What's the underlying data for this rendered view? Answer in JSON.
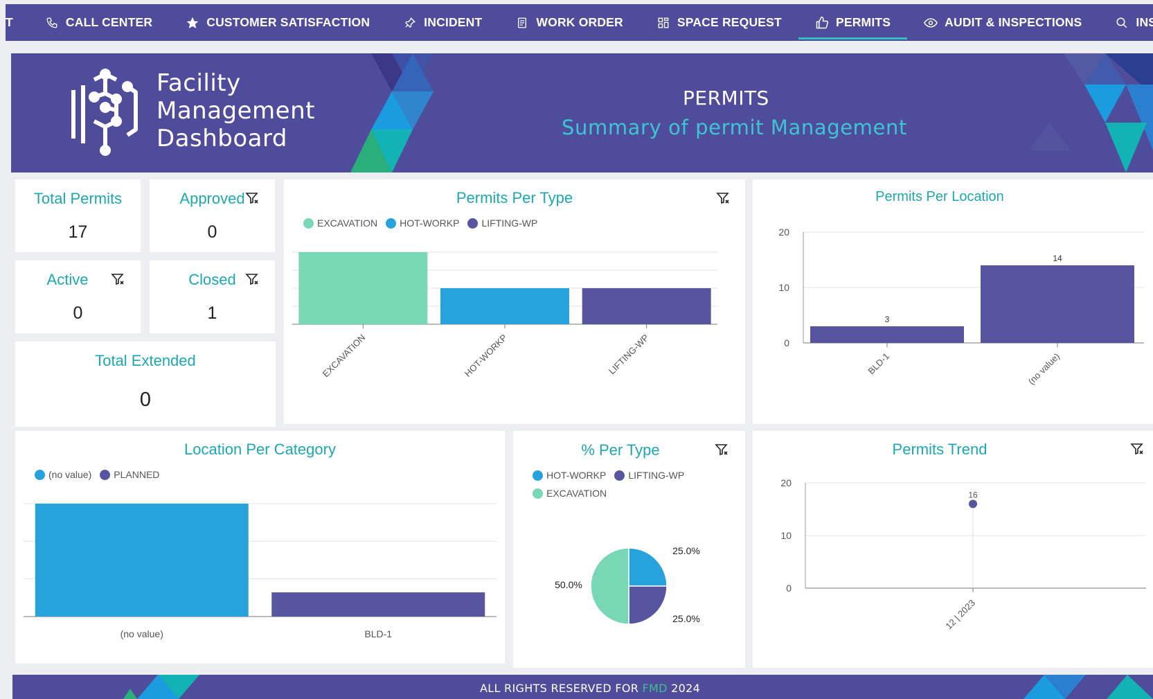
{
  "nav": {
    "items": [
      {
        "label": "T",
        "icon": "cut-off-icon"
      },
      {
        "label": "CALL CENTER",
        "icon": "phone-icon"
      },
      {
        "label": "CUSTOMER SATISFACTION",
        "icon": "star-icon"
      },
      {
        "label": "INCIDENT",
        "icon": "pin-icon"
      },
      {
        "label": "WORK ORDER",
        "icon": "clipboard-icon"
      },
      {
        "label": "SPACE REQUEST",
        "icon": "grid-icon"
      },
      {
        "label": "PERMITS",
        "icon": "thumbs-up-icon",
        "active": true
      },
      {
        "label": "AUDIT & INSPECTIONS",
        "icon": "eye-icon"
      },
      {
        "label": "INSPEC",
        "icon": "search-icon"
      }
    ],
    "accent_color": "#2ec0c4"
  },
  "header": {
    "brand_line1": "Facility",
    "brand_line2": "Management",
    "brand_line3": "Dashboard",
    "title": "PERMITS",
    "subtitle": "Summary of permit Management",
    "background_color": "#4f4c9b"
  },
  "kpis": {
    "total_permits": {
      "label": "Total Permits",
      "value": "17"
    },
    "approved": {
      "label": "Approved",
      "value": "0"
    },
    "active": {
      "label": "Active",
      "value": "0"
    },
    "closed": {
      "label": "Closed",
      "value": "1"
    },
    "total_extended": {
      "label": "Total Extended",
      "value": "0"
    }
  },
  "panels": {
    "permits_per_type": "Permits Per Type",
    "permits_per_location": "Permits Per Location",
    "location_per_category": "Location Per Category",
    "percent_per_type": "% Per Type",
    "permits_trend": "Permits Trend"
  },
  "colors": {
    "excavation": "#78d8b6",
    "hot_workp": "#27a2dc",
    "lifting_wp": "#57559f",
    "title_teal": "#1ea7b3"
  },
  "chart_data": [
    {
      "id": "permits_per_type",
      "type": "bar",
      "title": "Permits Per Type",
      "categories": [
        "EXCAVATION",
        "HOT-WORKP",
        "LIFTING-WP"
      ],
      "values": [
        2,
        1,
        1
      ],
      "colors": [
        "#78d8b6",
        "#27a2dc",
        "#57559f"
      ],
      "legend": [
        "EXCAVATION",
        "HOT-WORKP",
        "LIFTING-WP"
      ],
      "ylim": [
        0,
        2
      ],
      "grid": true,
      "legend_position": "top-left"
    },
    {
      "id": "permits_per_location",
      "type": "bar",
      "title": "Permits Per Location",
      "categories": [
        "BLD-1",
        "(no value)"
      ],
      "values": [
        3,
        14
      ],
      "data_labels": [
        "3",
        "14"
      ],
      "y_ticks": [
        "0",
        "10",
        "20"
      ],
      "ylim": [
        0,
        20
      ],
      "color": "#57559f",
      "grid": true
    },
    {
      "id": "location_per_category",
      "type": "bar",
      "title": "Location Per Category",
      "categories": [
        "(no value)",
        "BLD-1"
      ],
      "series": [
        {
          "name": "(no value)",
          "values": [
            14,
            null
          ]
        },
        {
          "name": "PLANNED",
          "values": [
            null,
            3
          ]
        }
      ],
      "colors": [
        "#27a2dc",
        "#57559f"
      ],
      "legend": [
        "(no value)",
        "PLANNED"
      ],
      "ylim": [
        0,
        14
      ],
      "grid": true,
      "legend_position": "top-left"
    },
    {
      "id": "percent_per_type",
      "type": "pie",
      "title": "% Per Type",
      "labels": [
        "HOT-WORKP",
        "LIFTING-WP",
        "EXCAVATION"
      ],
      "values": [
        25.0,
        25.0,
        50.0
      ],
      "data_labels": [
        "25.0%",
        "25.0%",
        "50.0%"
      ],
      "colors": [
        "#27a2dc",
        "#57559f",
        "#78d8b6"
      ],
      "legend": [
        "HOT-WORKP",
        "LIFTING-WP",
        "EXCAVATION"
      ],
      "legend_position": "top-left"
    },
    {
      "id": "permits_trend",
      "type": "scatter",
      "title": "Permits Trend",
      "x": [
        "12 | 2023"
      ],
      "y": [
        16
      ],
      "data_labels": [
        "16"
      ],
      "y_ticks": [
        "0",
        "10",
        "20"
      ],
      "ylim": [
        0,
        20
      ],
      "color": "#57559f",
      "grid": true
    }
  ],
  "footer": {
    "text_before": "ALL RIGHTS RESERVED FOR",
    "brand": "FMD",
    "year": "2024"
  }
}
